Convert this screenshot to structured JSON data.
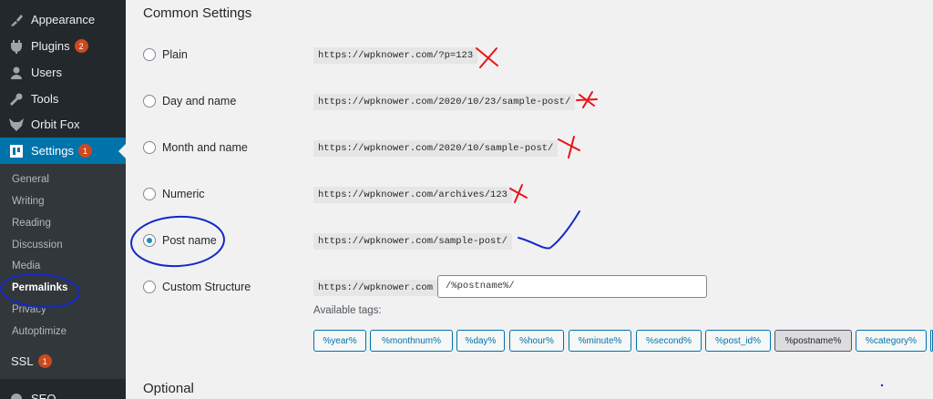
{
  "sidebar": {
    "menu": [
      {
        "label": "Appearance",
        "icon": "paintbrush-icon"
      },
      {
        "label": "Plugins",
        "icon": "plug-icon",
        "badge": "2"
      },
      {
        "label": "Users",
        "icon": "user-icon"
      },
      {
        "label": "Tools",
        "icon": "wrench-icon"
      },
      {
        "label": "Orbit Fox",
        "icon": "fox-icon"
      },
      {
        "label": "Settings",
        "icon": "settings-icon",
        "badge": "1"
      }
    ],
    "submenu": [
      "General",
      "Writing",
      "Reading",
      "Discussion",
      "Media",
      "Permalinks",
      "Privacy",
      "Autoptimize"
    ],
    "ssl": {
      "label": "SSL",
      "badge": "1"
    },
    "seo": {
      "label": "SEO"
    }
  },
  "main": {
    "common_title": "Common Settings",
    "options": [
      {
        "label": "Plain",
        "example": "https://wpknower.com/?p=123",
        "checked": false
      },
      {
        "label": "Day and name",
        "example": "https://wpknower.com/2020/10/23/sample-post/",
        "checked": false
      },
      {
        "label": "Month and name",
        "example": "https://wpknower.com/2020/10/sample-post/",
        "checked": false
      },
      {
        "label": "Numeric",
        "example": "https://wpknower.com/archives/123",
        "checked": false
      },
      {
        "label": "Post name",
        "example": "https://wpknower.com/sample-post/",
        "checked": true
      },
      {
        "label": "Custom Structure",
        "example": "https://wpknower.com",
        "checked": false
      }
    ],
    "custom_value": "/%postname%/",
    "available_tags_label": "Available tags:",
    "tags": [
      "%year%",
      "%monthnum%",
      "%day%",
      "%hour%",
      "%minute%",
      "%second%",
      "%post_id%",
      "%postname%",
      "%category%"
    ],
    "optional_title": "Optional"
  },
  "colors": {
    "sidebar": "#23282d",
    "accent": "#0073aa",
    "badge": "#ca4a1f",
    "annotation_red": "#e8141c",
    "annotation_blue": "#1428c8"
  }
}
